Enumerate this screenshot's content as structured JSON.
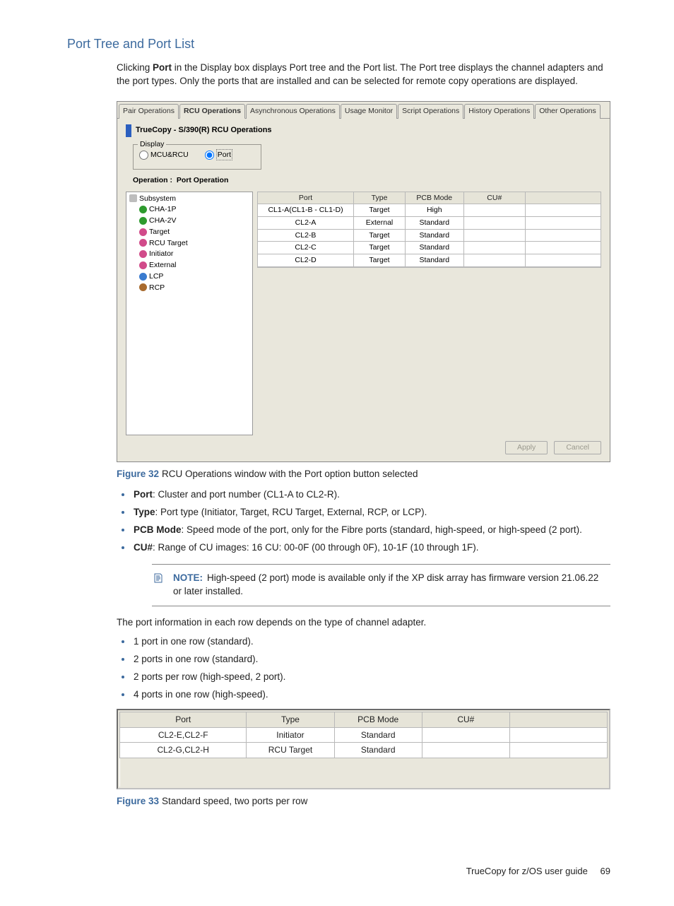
{
  "heading": "Port Tree and Port List",
  "intro_before": "Clicking ",
  "intro_bold": "Port",
  "intro_after": " in the Display box displays Port tree and the Port list. The Port tree displays the channel adapters and the port types. Only the ports that are installed and can be selected for remote copy operations are displayed.",
  "tabs": {
    "t0": "Pair Operations",
    "t1": "RCU Operations",
    "t2": "Asynchronous Operations",
    "t3": "Usage Monitor",
    "t4": "Script Operations",
    "t5": "History Operations",
    "t6": "Other Operations"
  },
  "pane_title": "TrueCopy - S/390(R) RCU Operations",
  "display_legend": "Display",
  "radio_mcu": "MCU&RCU",
  "radio_port": "Port",
  "op_label": "Operation :",
  "op_value": "Port Operation",
  "tree": {
    "root": "Subsystem",
    "cha1p": "CHA-1P",
    "cha2v": "CHA-2V",
    "target": "Target",
    "rcut": "RCU Target",
    "init": "Initiator",
    "ext": "External",
    "lcp": "LCP",
    "rcp": "RCP"
  },
  "thead": {
    "port": "Port",
    "type": "Type",
    "pcb": "PCB Mode",
    "cu": "CU#"
  },
  "rows": {
    "r0": {
      "port": "CL1-A(CL1-B - CL1-D)",
      "type": "Target",
      "pcb": "High",
      "cu": ""
    },
    "r1": {
      "port": "CL2-A",
      "type": "External",
      "pcb": "Standard",
      "cu": ""
    },
    "r2": {
      "port": "CL2-B",
      "type": "Target",
      "pcb": "Standard",
      "cu": ""
    },
    "r3": {
      "port": "CL2-C",
      "type": "Target",
      "pcb": "Standard",
      "cu": ""
    },
    "r4": {
      "port": "CL2-D",
      "type": "Target",
      "pcb": "Standard",
      "cu": ""
    }
  },
  "apply_btn": "Apply",
  "cancel_btn": "Cancel",
  "fig32_label": "Figure 32",
  "fig32_caption": "RCU Operations window with the Port option button selected",
  "bul1": {
    "term": "Port",
    "rest": ": Cluster and port number (CL1-A to CL2-R)."
  },
  "bul2": {
    "term": "Type",
    "rest": ": Port type (Initiator, Target, RCU Target, External, RCP, or LCP)."
  },
  "bul3": {
    "term": "PCB Mode",
    "rest": ": Speed mode of the port, only for the Fibre ports (standard, high-speed, or high-speed (2 port)."
  },
  "bul4": {
    "term": "CU#",
    "rest": ": Range of CU images: 16 CU: 00-0F (00 through 0F), 10-1F (10 through 1F)."
  },
  "note_label": "NOTE:",
  "note_text": "High-speed (2 port) mode is available only if the XP disk array has firmware version 21.06.22 or later installed.",
  "body_p": "The port information in each row depends on the type of channel adapter.",
  "bul5": "1 port in one row (standard).",
  "bul6": "2 ports in one row (standard).",
  "bul7": "2 ports per row (high-speed, 2 port).",
  "bul8": "4 ports in one row (high-speed).",
  "fig33": {
    "head": {
      "port": "Port",
      "type": "Type",
      "pcb": "PCB Mode",
      "cu": "CU#"
    },
    "r0": {
      "port": "CL2-E,CL2-F",
      "type": "Initiator",
      "pcb": "Standard",
      "cu": ""
    },
    "r1": {
      "port": "CL2-G,CL2-H",
      "type": "RCU Target",
      "pcb": "Standard",
      "cu": ""
    }
  },
  "fig33_label": "Figure 33",
  "fig33_caption": "Standard speed, two ports per row",
  "footer_text": "TrueCopy for z/OS user guide",
  "footer_page": "69"
}
